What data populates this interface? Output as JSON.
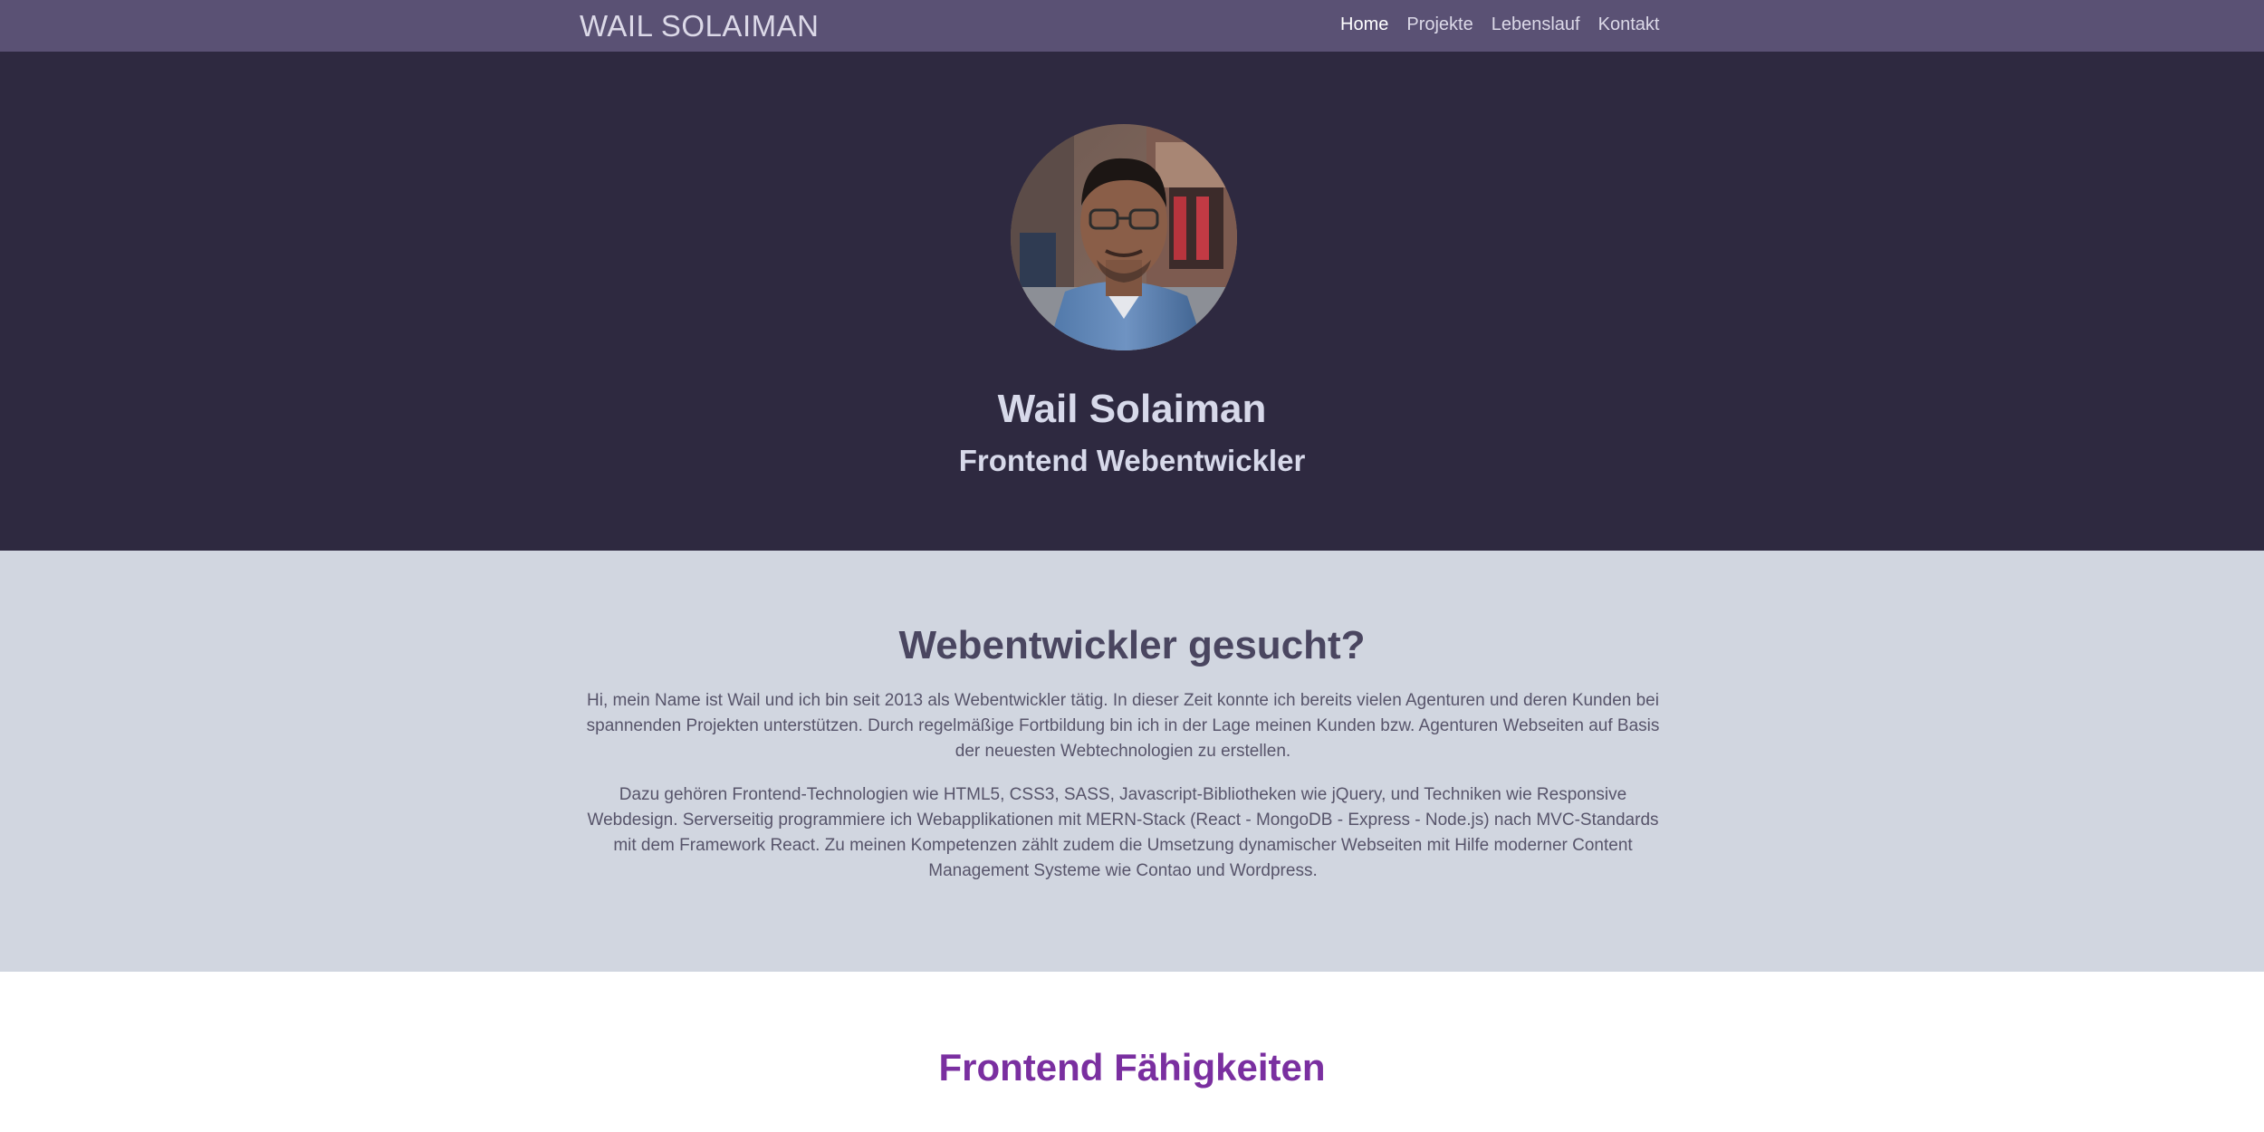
{
  "navbar": {
    "brand": "WAIL SOLAIMAN",
    "links": [
      {
        "label": "Home",
        "active": true
      },
      {
        "label": "Projekte",
        "active": false
      },
      {
        "label": "Lebenslauf",
        "active": false
      },
      {
        "label": "Kontakt",
        "active": false
      }
    ]
  },
  "hero": {
    "name": "Wail Solaiman",
    "role": "Frontend Webentwickler"
  },
  "about": {
    "title": "Webentwickler gesucht?",
    "paragraph1": "Hi, mein Name ist Wail und ich bin seit 2013 als Webentwickler tätig. In dieser Zeit konnte ich bereits vielen Agenturen und deren Kunden bei spannenden Projekten unterstützen. Durch regelmäßige Fortbildung bin ich in der Lage meinen Kunden bzw. Agenturen Webseiten auf Basis der neuesten Webtechnologien zu erstellen.",
    "paragraph2": "Dazu gehören Frontend-Technologien wie HTML5, CSS3, SASS, Javascript-Bibliotheken wie jQuery, und Techniken wie Responsive Webdesign. Serverseitig programmiere ich Webapplikationen mit MERN-Stack (React - MongoDB - Express - Node.js) nach MVC-Standards mit dem Framework React. Zu meinen Kompetenzen zählt zudem die Umsetzung dynamischer Webseiten mit Hilfe moderner Content Management Systeme wie Contao und Wordpress."
  },
  "skills": {
    "title": "Frontend Fähigkeiten"
  },
  "colors": {
    "navbar_bg": "#5a5174",
    "hero_bg": "#2e2940",
    "about_bg": "#d1d6e0",
    "skills_title": "#7a2fa0"
  }
}
